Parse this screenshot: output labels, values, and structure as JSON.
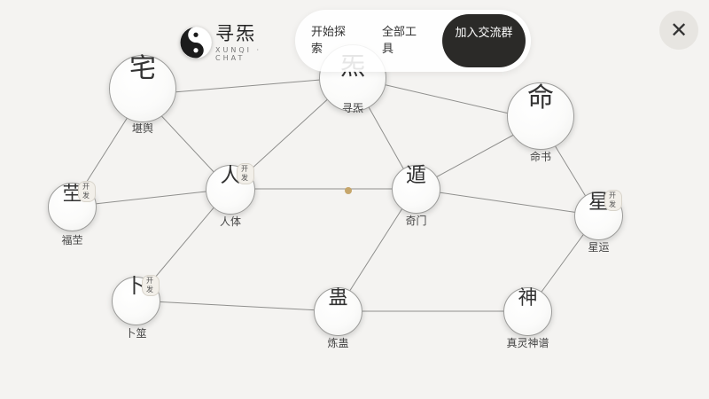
{
  "brand": {
    "name": "寻炁",
    "sub": "XUNQI · CHAT"
  },
  "nav": {
    "explore": "开始探索",
    "tools": "全部工具",
    "join": "加入交流群"
  },
  "close": {
    "symbol": "✕"
  },
  "nodes": [
    {
      "id": "xunqi",
      "glyph": "炁",
      "label": "寻炁",
      "badge": ""
    },
    {
      "id": "kanyu",
      "glyph": "宅",
      "label": "堪舆",
      "badge": ""
    },
    {
      "id": "mingshu",
      "glyph": "命",
      "label": "命书",
      "badge": ""
    },
    {
      "id": "fuying",
      "glyph": "茔",
      "label": "福茔",
      "badge": "开发"
    },
    {
      "id": "renti",
      "glyph": "人",
      "label": "人体",
      "badge": "开发"
    },
    {
      "id": "qimen",
      "glyph": "遁",
      "label": "奇门",
      "badge": ""
    },
    {
      "id": "xingyun",
      "glyph": "星",
      "label": "星运",
      "badge": "开发"
    },
    {
      "id": "buce",
      "glyph": "卜",
      "label": "卜筮",
      "badge": "开发"
    },
    {
      "id": "liangu",
      "glyph": "蛊",
      "label": "炼蛊",
      "badge": ""
    },
    {
      "id": "shenpu",
      "glyph": "神",
      "label": "真灵神谱",
      "badge": ""
    }
  ]
}
